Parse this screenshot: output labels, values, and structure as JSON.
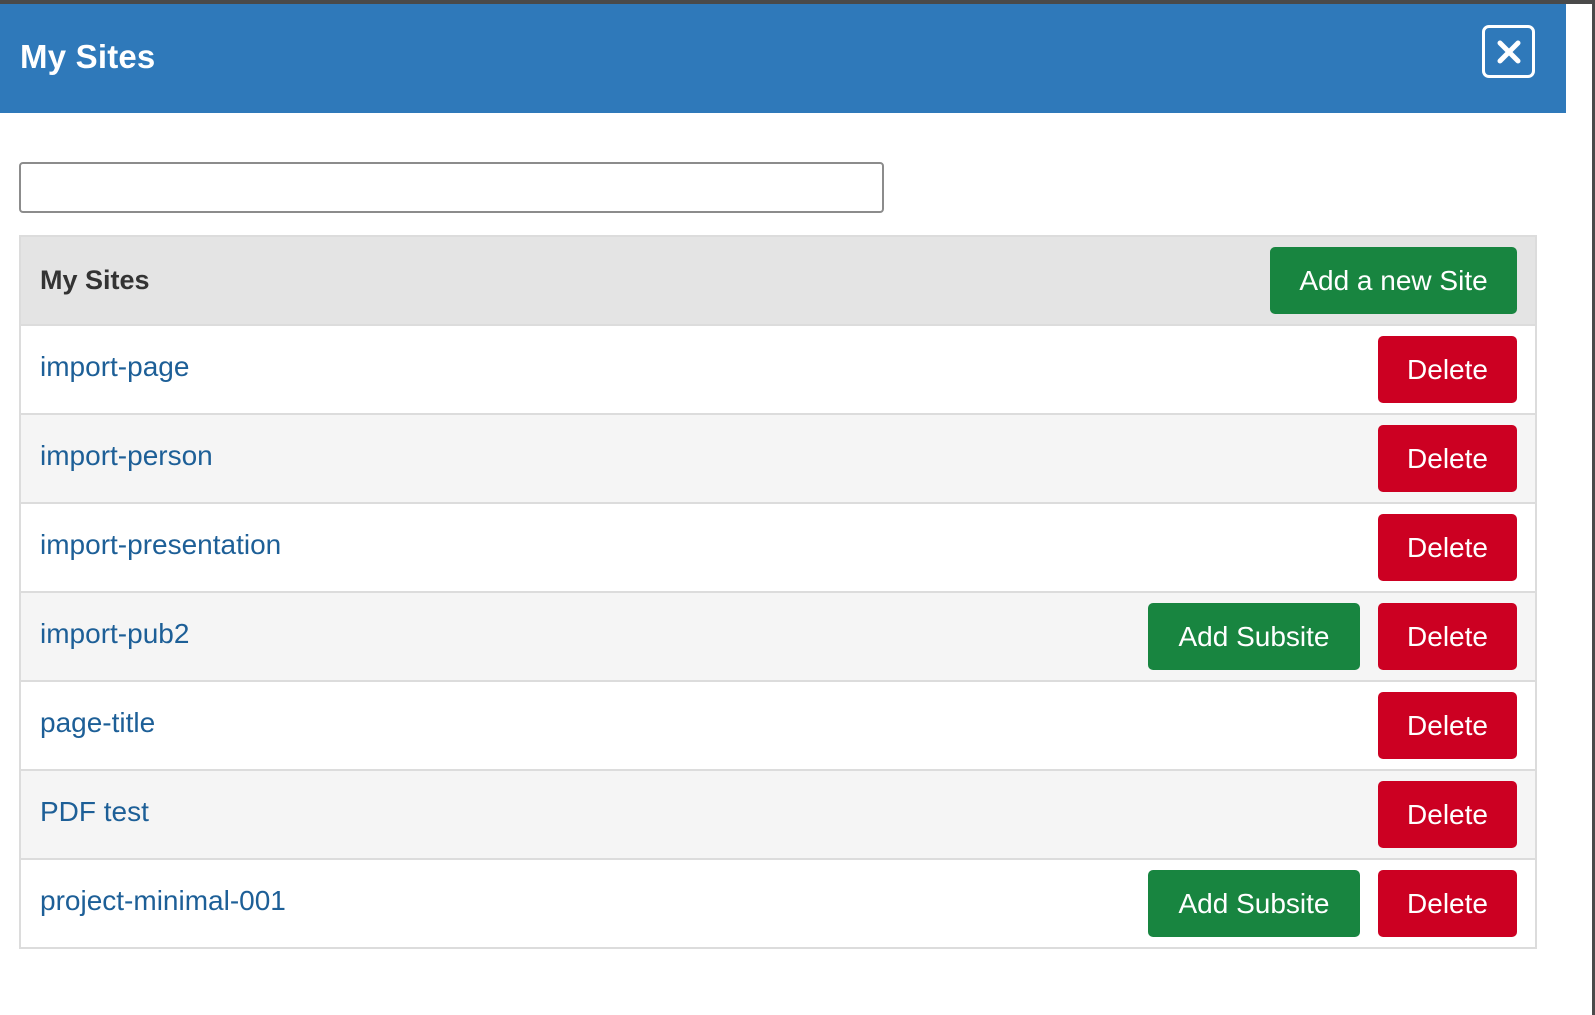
{
  "modal": {
    "title": "My Sites",
    "close_icon": "close-icon"
  },
  "search": {
    "value": "",
    "placeholder": ""
  },
  "table": {
    "title": "My Sites",
    "add_site_label": "Add a new Site",
    "rows": [
      {
        "name": "import-page",
        "has_subsite": false
      },
      {
        "name": "import-person",
        "has_subsite": false
      },
      {
        "name": "import-presentation",
        "has_subsite": false
      },
      {
        "name": "import-pub2",
        "has_subsite": true
      },
      {
        "name": "page-title",
        "has_subsite": false
      },
      {
        "name": "PDF test",
        "has_subsite": false
      },
      {
        "name": "project-minimal-001",
        "has_subsite": true
      }
    ],
    "delete_label": "Delete",
    "add_subsite_label": "Add Subsite"
  },
  "colors": {
    "header_bg": "#2f79ba",
    "green": "#188540",
    "red": "#cc0022",
    "link": "#1d5f97"
  }
}
